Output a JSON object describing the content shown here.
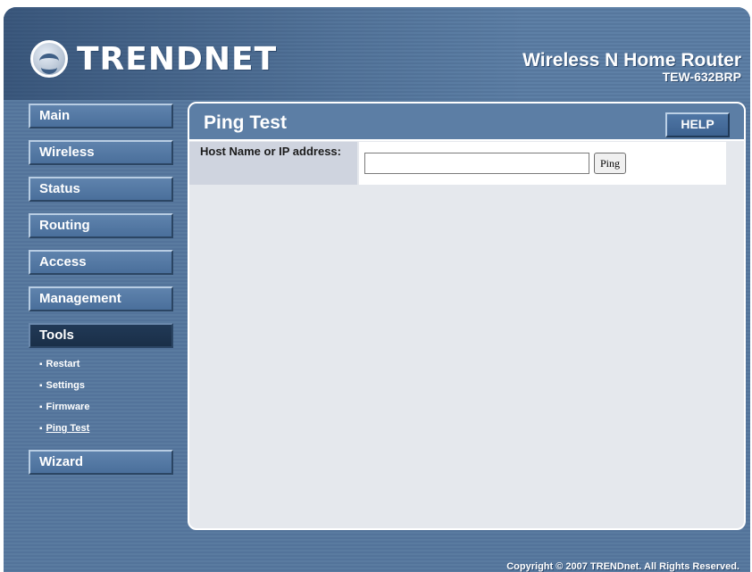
{
  "header": {
    "brand": "TRENDNET",
    "product_name": "Wireless N Home Router",
    "model": "TEW-632BRP"
  },
  "nav": {
    "items": [
      {
        "label": "Main"
      },
      {
        "label": "Wireless"
      },
      {
        "label": "Status"
      },
      {
        "label": "Routing"
      },
      {
        "label": "Access"
      },
      {
        "label": "Management"
      },
      {
        "label": "Tools"
      },
      {
        "label": "Wizard"
      }
    ],
    "tools_sub": [
      {
        "label": "Restart"
      },
      {
        "label": "Settings"
      },
      {
        "label": "Firmware"
      },
      {
        "label": "Ping Test"
      }
    ],
    "bullet": "▪",
    "active": "Tools",
    "current_sub": "Ping Test"
  },
  "content": {
    "title": "Ping Test",
    "help_label": "HELP",
    "host_label": "Host Name or IP address:",
    "host_value": "",
    "host_placeholder": "",
    "ping_label": "Ping"
  },
  "footer": {
    "copyright": "Copyright © 2007 TRENDnet. All Rights Reserved."
  },
  "colors": {
    "frame": "#5a7ba0",
    "nav_button": "#557aa5",
    "nav_active": "#1f3652",
    "content_bg": "#e5e8ed",
    "label_bg": "#cfd4df"
  },
  "icons": {
    "logo": "trendnet-logo-icon"
  }
}
